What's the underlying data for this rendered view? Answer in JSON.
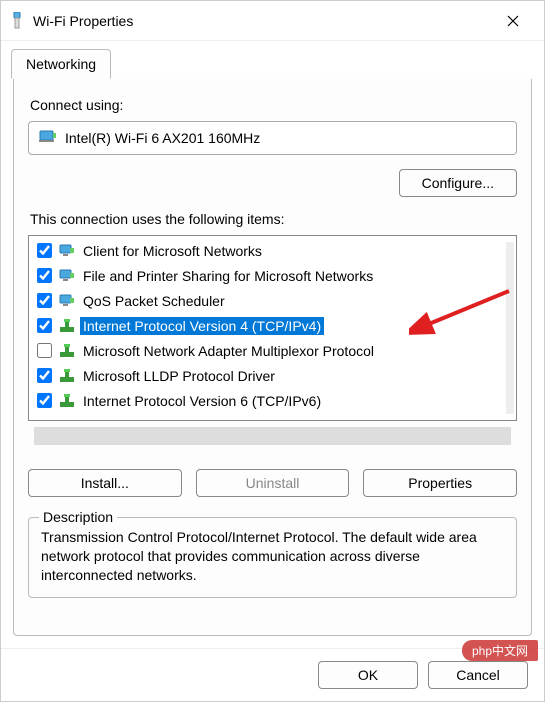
{
  "window": {
    "title": "Wi-Fi Properties"
  },
  "tab": {
    "label": "Networking"
  },
  "connect": {
    "label": "Connect using:",
    "device": "Intel(R) Wi-Fi 6 AX201 160MHz"
  },
  "configure_btn": "Configure...",
  "items_label": "This connection uses the following items:",
  "items": [
    {
      "checked": true,
      "icon": "monitor",
      "label": "Client for Microsoft Networks",
      "selected": false
    },
    {
      "checked": true,
      "icon": "monitor",
      "label": "File and Printer Sharing for Microsoft Networks",
      "selected": false
    },
    {
      "checked": true,
      "icon": "monitor",
      "label": "QoS Packet Scheduler",
      "selected": false
    },
    {
      "checked": true,
      "icon": "net",
      "label": "Internet Protocol Version 4 (TCP/IPv4)",
      "selected": true
    },
    {
      "checked": false,
      "icon": "net",
      "label": "Microsoft Network Adapter Multiplexor Protocol",
      "selected": false
    },
    {
      "checked": true,
      "icon": "net",
      "label": "Microsoft LLDP Protocol Driver",
      "selected": false
    },
    {
      "checked": true,
      "icon": "net",
      "label": "Internet Protocol Version 6 (TCP/IPv6)",
      "selected": false
    }
  ],
  "buttons": {
    "install": "Install...",
    "uninstall": "Uninstall",
    "properties": "Properties"
  },
  "description": {
    "title": "Description",
    "text": "Transmission Control Protocol/Internet Protocol. The default wide area network protocol that provides communication across diverse interconnected networks."
  },
  "footer": {
    "ok": "OK",
    "cancel": "Cancel"
  },
  "watermark": "php中文网"
}
